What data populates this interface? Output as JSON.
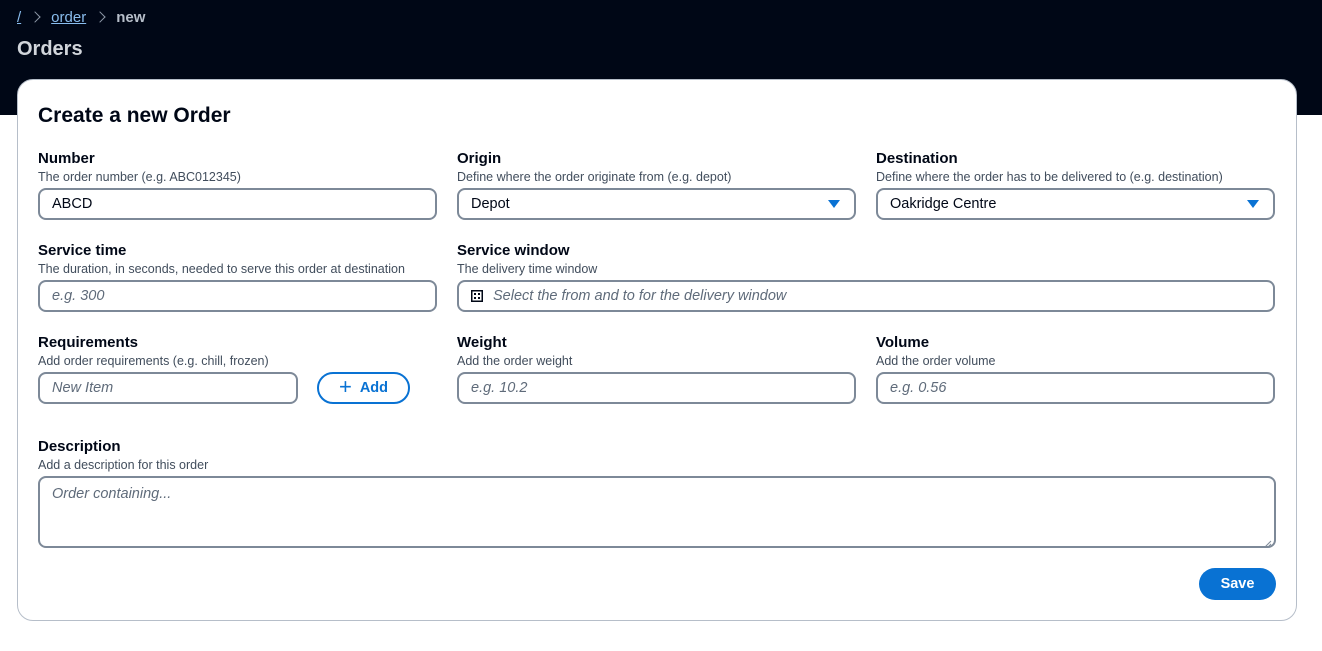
{
  "breadcrumb": {
    "root": "/",
    "order": "order",
    "current": "new"
  },
  "page": {
    "title": "Orders"
  },
  "form": {
    "title": "Create a new Order",
    "number": {
      "label": "Number",
      "description": "The order number (e.g. ABC012345)",
      "value": "ABCD"
    },
    "origin": {
      "label": "Origin",
      "description": "Define where the order originate from (e.g. depot)",
      "value": "Depot"
    },
    "destination": {
      "label": "Destination",
      "description": "Define where the order has to be delivered to (e.g. destination)",
      "value": "Oakridge Centre"
    },
    "service_time": {
      "label": "Service time",
      "description": "The duration, in seconds, needed to serve this order at destination",
      "placeholder": "e.g. 300"
    },
    "service_window": {
      "label": "Service window",
      "description": "The delivery time window",
      "placeholder": "Select the from and to for the delivery window"
    },
    "requirements": {
      "label": "Requirements",
      "description": "Add order requirements (e.g. chill, frozen)",
      "placeholder": "New Item",
      "add_label": "Add"
    },
    "weight": {
      "label": "Weight",
      "description": "Add the order weight",
      "placeholder": "e.g. 10.2"
    },
    "volume": {
      "label": "Volume",
      "description": "Add the order volume",
      "placeholder": "e.g. 0.56"
    },
    "description": {
      "label": "Description",
      "description": "Add a description for this order",
      "placeholder": "Order containing..."
    },
    "save_label": "Save"
  },
  "colors": {
    "header_bg": "#000716",
    "accent": "#0972d3",
    "link": "#89bdee"
  }
}
